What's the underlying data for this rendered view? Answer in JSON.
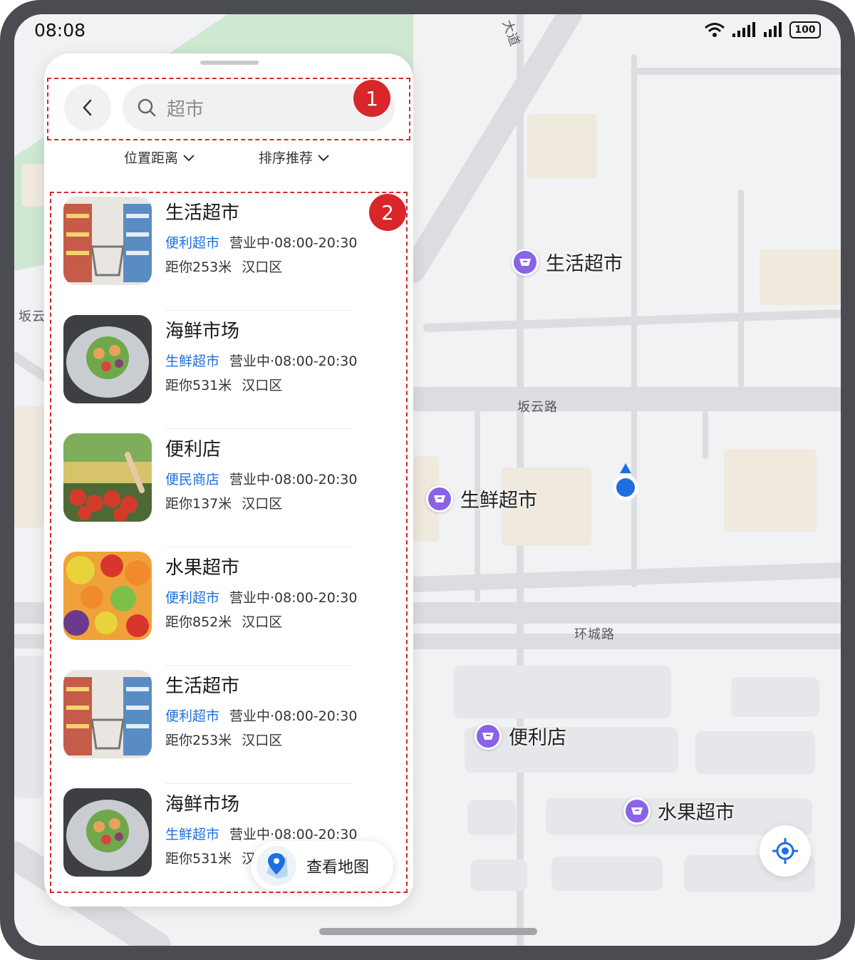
{
  "status_bar": {
    "time": "08:08",
    "battery": "100"
  },
  "map": {
    "road_labels": [
      "大道",
      "坂云",
      "坂云路",
      "环城路"
    ],
    "pois": [
      {
        "name": "生活超市",
        "icon": "shopping-basket-icon"
      },
      {
        "name": "生鲜超市",
        "icon": "shopping-basket-icon"
      },
      {
        "name": "便利店",
        "icon": "shopping-basket-icon"
      },
      {
        "name": "水果超市",
        "icon": "shopping-basket-icon"
      }
    ],
    "poi_color": "#8a63e8",
    "user_location_color": "#1f6fe0"
  },
  "search": {
    "query": "超市",
    "back_icon": "chevron-left-icon",
    "search_icon": "search-icon"
  },
  "filters": [
    {
      "label": "位置距离",
      "icon": "chevron-down-icon"
    },
    {
      "label": "排序推荐",
      "icon": "chevron-down-icon"
    }
  ],
  "results": [
    {
      "name": "生活超市",
      "tag": "便利超市",
      "status": "营业中·08:00-20:30",
      "distance": "距你253米",
      "district": "汉口区",
      "image": "supermarket-aisle"
    },
    {
      "name": "海鲜市场",
      "tag": "生鲜超市",
      "status": "营业中·08:00-20:30",
      "distance": "距你531米",
      "district": "汉口区",
      "image": "salad-plate"
    },
    {
      "name": "便利店",
      "tag": "便民商店",
      "status": "营业中·08:00-20:30",
      "distance": "距你137米",
      "district": "汉口区",
      "image": "vegetable-stand"
    },
    {
      "name": "水果超市",
      "tag": "便利超市",
      "status": "营业中·08:00-20:30",
      "distance": "距你852米",
      "district": "汉口区",
      "image": "fruit-pile"
    },
    {
      "name": "生活超市",
      "tag": "便利超市",
      "status": "营业中·08:00-20:30",
      "distance": "距你253米",
      "district": "汉口区",
      "image": "supermarket-aisle"
    },
    {
      "name": "海鲜市场",
      "tag": "生鲜超市",
      "status": "营业中·08:00-20:30",
      "distance": "距你531米",
      "district": "汉口区",
      "image": "salad-plate"
    }
  ],
  "view_map_button": {
    "label": "查看地图",
    "icon": "map-pin-icon"
  },
  "annotations": [
    {
      "number": "1"
    },
    {
      "number": "2"
    }
  ],
  "colors": {
    "accent": "#1f6fe0",
    "annotation": "#d8262b"
  }
}
